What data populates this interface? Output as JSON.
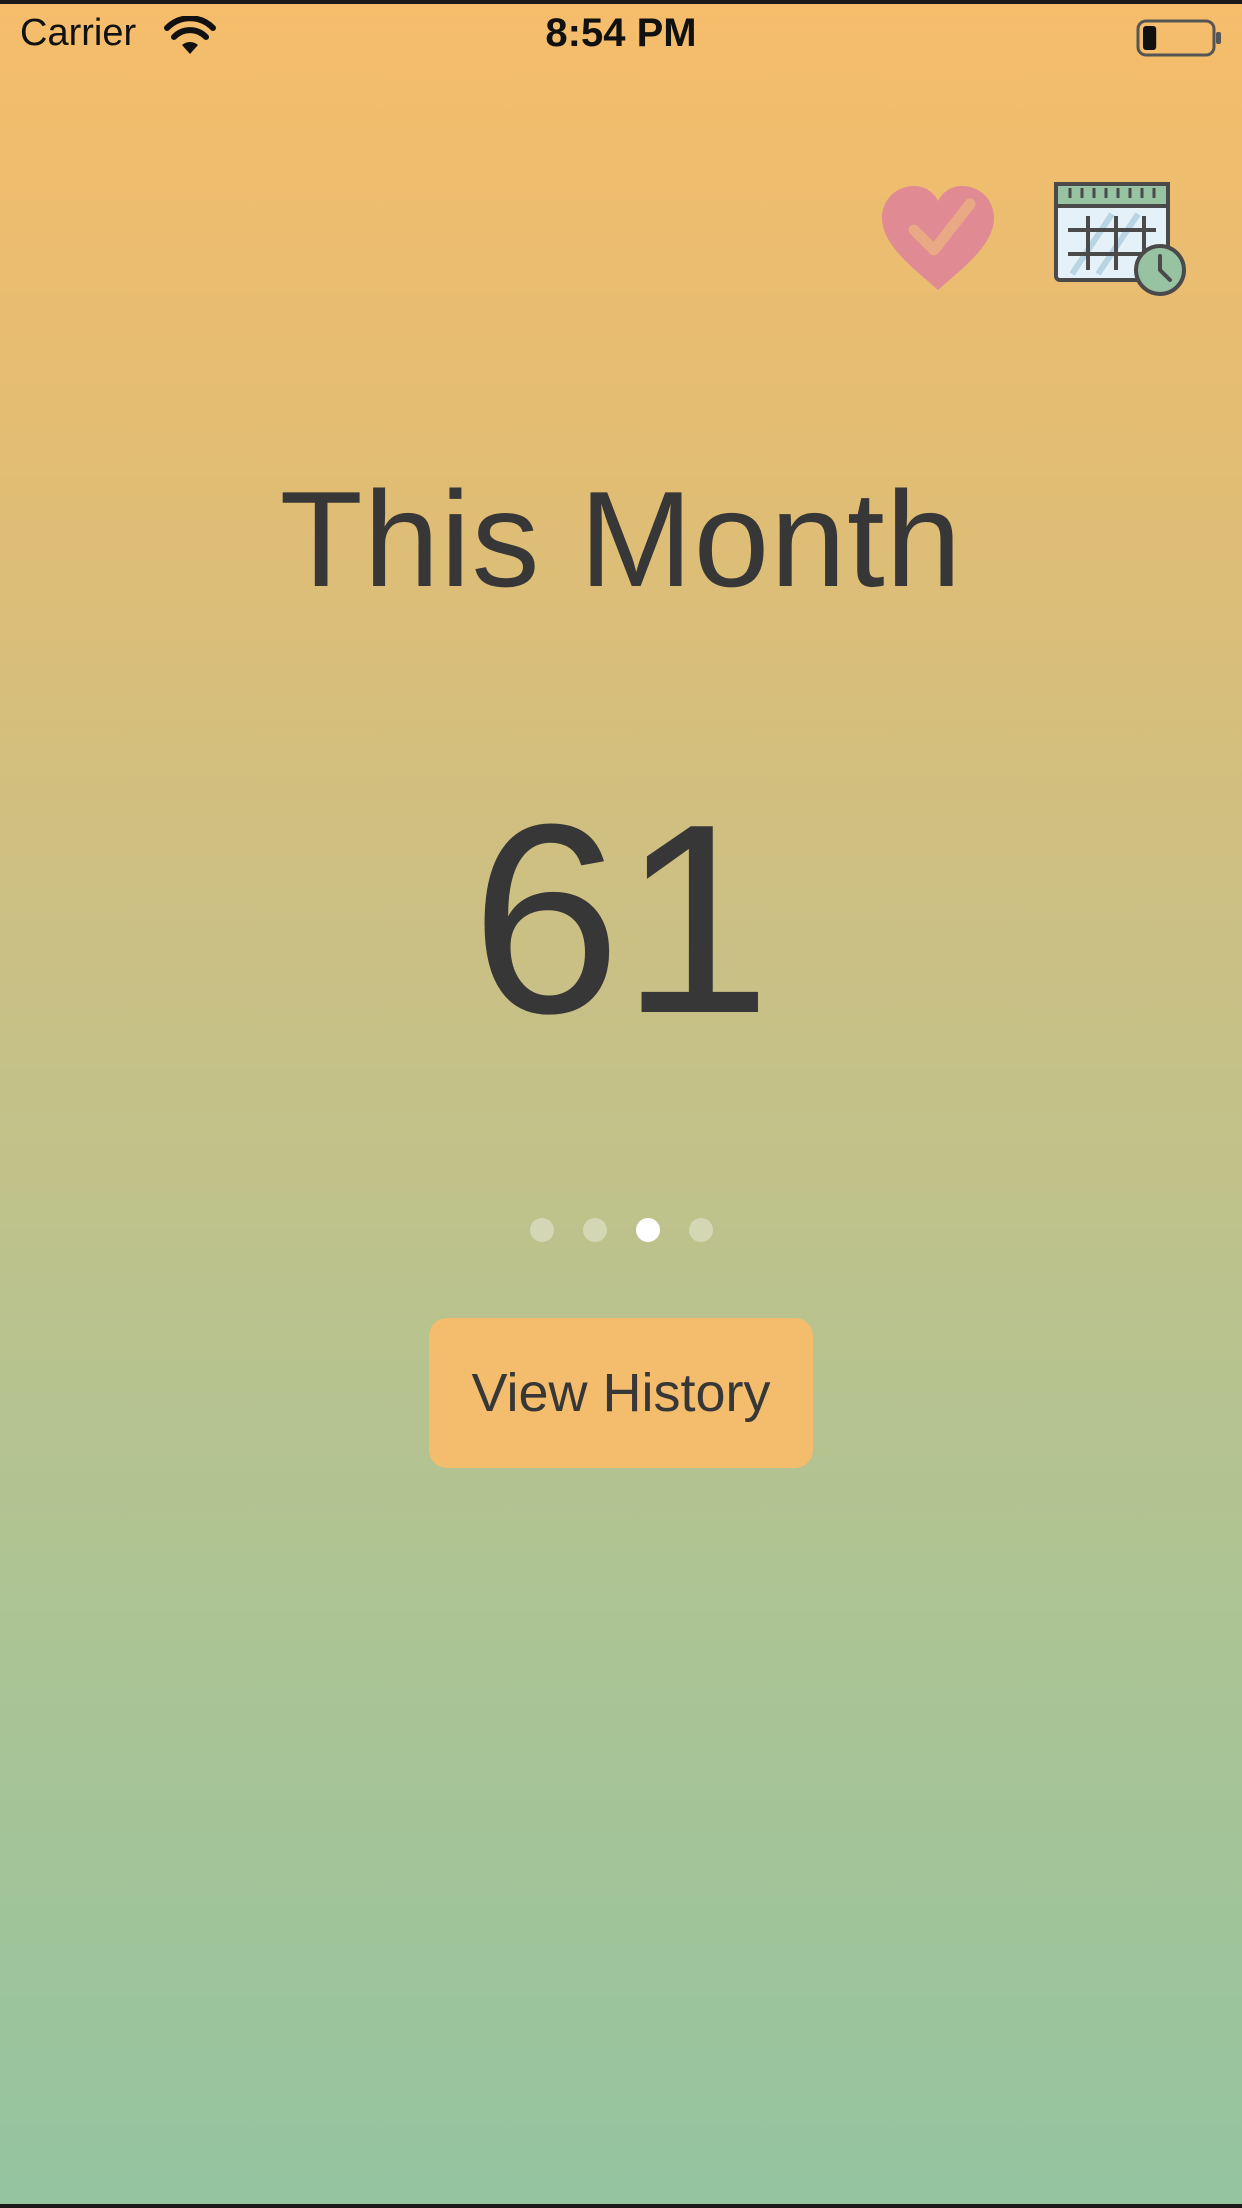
{
  "status_bar": {
    "carrier": "Carrier",
    "time": "8:54 PM",
    "wifi_icon": "wifi-icon",
    "battery_icon": "battery-icon",
    "battery_level": 0.2
  },
  "header": {
    "health_icon": "heart-check-icon",
    "history_calendar_icon": "calendar-clock-icon"
  },
  "main": {
    "title": "This Month",
    "count": "61"
  },
  "pager": {
    "page_count": 4,
    "active_index": 2
  },
  "actions": {
    "view_history_label": "View History"
  },
  "colors": {
    "gradient_top": "#f6bd6b",
    "gradient_bottom": "#94c4a0",
    "button_bg": "#f3bd6d",
    "heart": "#e08a93",
    "text": "#373737"
  }
}
